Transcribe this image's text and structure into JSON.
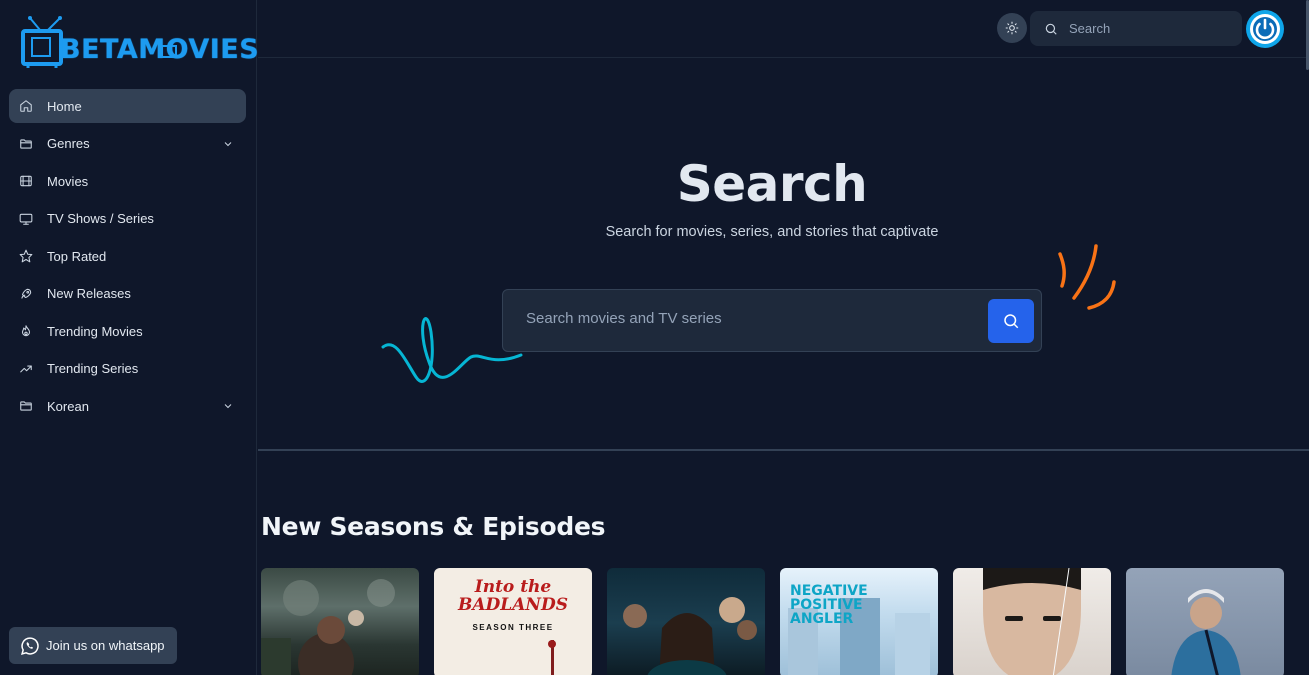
{
  "app": {
    "logo_text": "BETAMOVIES"
  },
  "sidebar": {
    "items": [
      {
        "label": "Home",
        "icon": "home-icon",
        "active": true
      },
      {
        "label": "Genres",
        "icon": "folder-icon",
        "has_submenu": true
      },
      {
        "label": "Movies",
        "icon": "film-icon"
      },
      {
        "label": "TV Shows / Series",
        "icon": "tv-icon"
      },
      {
        "label": "Top Rated",
        "icon": "star-icon"
      },
      {
        "label": "New Releases",
        "icon": "rocket-icon"
      },
      {
        "label": "Trending Movies",
        "icon": "flame-icon"
      },
      {
        "label": "Trending Series",
        "icon": "trending-up-icon"
      },
      {
        "label": "Korean",
        "icon": "folder-icon",
        "has_submenu": true
      }
    ],
    "whatsapp_label": "Join us on whatsapp"
  },
  "topbar": {
    "search_placeholder": "Search"
  },
  "hero": {
    "title": "Search",
    "subtitle": "Search for movies, series, and stories that captivate",
    "search_placeholder": "Search movies and TV series"
  },
  "section": {
    "title": "New Seasons & Episodes",
    "cards": [
      {
        "text": ""
      },
      {
        "text": "Into the BADLANDS",
        "subtext": "SEASON THREE"
      },
      {
        "text": ""
      },
      {
        "text": "NEGATIVE POSITIVE ANGLER"
      },
      {
        "text": ""
      },
      {
        "text": ""
      }
    ]
  },
  "colors": {
    "background": "#0f172a",
    "accent": "#2563eb",
    "logo": "#1d9bf0",
    "active_nav": "#334155"
  }
}
